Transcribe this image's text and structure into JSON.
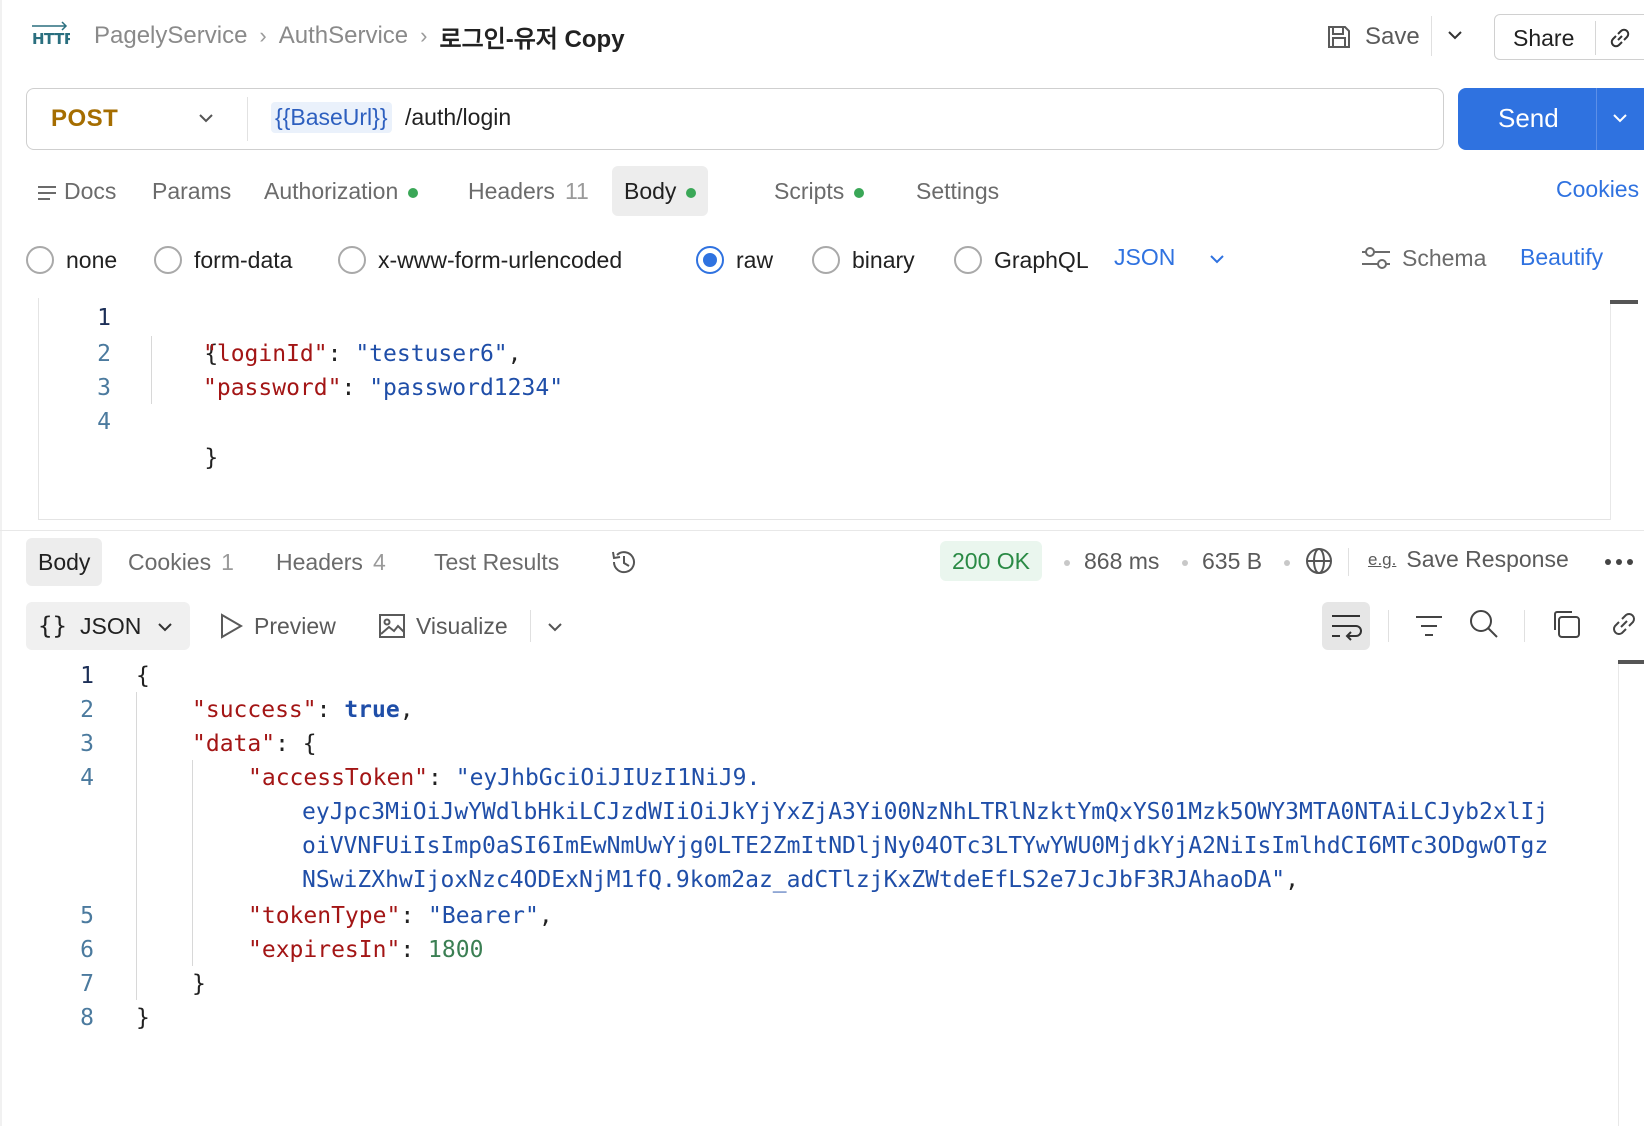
{
  "header": {
    "breadcrumb": [
      "PagelyService",
      "AuthService",
      "로그인-유저 Copy"
    ],
    "http_badge": "HTTP",
    "save_label": "Save",
    "share_label": "Share"
  },
  "request": {
    "method": "POST",
    "url_variable": "{{BaseUrl}}",
    "url_path": "/auth/login",
    "send_label": "Send"
  },
  "request_tabs": {
    "docs": "Docs",
    "params": "Params",
    "authorization": "Authorization",
    "headers": "Headers",
    "headers_count": "11",
    "body": "Body",
    "scripts": "Scripts",
    "settings": "Settings",
    "cookies": "Cookies"
  },
  "body_types": {
    "none": "none",
    "form_data": "form-data",
    "urlencoded": "x-www-form-urlencoded",
    "raw": "raw",
    "binary": "binary",
    "graphql": "GraphQL",
    "selected": "raw",
    "language": "JSON",
    "schema": "Schema",
    "beautify": "Beautify"
  },
  "request_body": {
    "line_numbers": [
      "1",
      "2",
      "3",
      "4"
    ],
    "open_brace": "{",
    "close_brace": "}",
    "login_key": "\"loginId\"",
    "login_value": "\"testuser6\"",
    "password_key": "\"password\"",
    "password_value": "\"password1234\""
  },
  "response_tabs": {
    "body": "Body",
    "cookies": "Cookies",
    "cookies_count": "1",
    "headers": "Headers",
    "headers_count": "4",
    "test_results": "Test Results"
  },
  "response_meta": {
    "status": "200 OK",
    "time": "868 ms",
    "size": "635 B",
    "save_response": "Save Response",
    "eg_label": "e.g."
  },
  "response_toolbar": {
    "format": "JSON",
    "preview": "Preview",
    "visualize": "Visualize"
  },
  "response_body": {
    "line_numbers": [
      "1",
      "2",
      "3",
      "4",
      "5",
      "6",
      "7",
      "8"
    ],
    "open_brace": "{",
    "close_brace": "}",
    "success_key": "\"success\"",
    "success_value": "true",
    "data_key": "\"data\"",
    "access_token_key": "\"accessToken\"",
    "access_token_lines": [
      "\"eyJhbGciOiJIUzI1NiJ9.",
      "eyJpc3MiOiJwYWdlbHkiLCJzdWIiOiJkYjYxZjA3Yi00NzNhLTRlNzktYmQxYS01Mzk5OWY3MTA0NTAiLCJyb2xlIj",
      "oiVVNFUiIsImp0aSI6ImEwNmUwYjg0LTE2ZmItNDljNy04OTc3LTYwYWU0MjdkYjA2NiIsImlhdCI6MTc3ODgwOTgz",
      "NSwiZXhwIjoxNzc4ODExNjM1fQ.9kom2az_adCTlzjKxZWtdeEfLS2e7JcJbF3RJAhaoDA\""
    ],
    "token_type_key": "\"tokenType\"",
    "token_type_value": "\"Bearer\"",
    "expires_in_key": "\"expiresIn\"",
    "expires_in_value": "1800"
  },
  "colors": {
    "accent": "#2f72e0",
    "method": "#a56d00",
    "status_ok": "#2a8a45",
    "indicator_dot": "#3aa757"
  },
  "icons": [
    "http-icon",
    "chevron-down-icon",
    "save-icon",
    "link-icon",
    "docs-icon",
    "schema-icon",
    "history-icon",
    "globe-icon",
    "more-icon",
    "preview-icon",
    "visualize-icon",
    "wrap-icon",
    "filter-icon",
    "search-icon",
    "copy-icon"
  ]
}
